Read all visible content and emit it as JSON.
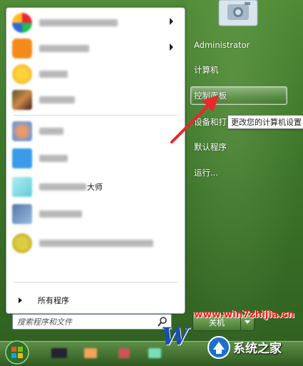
{
  "right_menu": {
    "user": "Administrator",
    "computer": "计算机",
    "control_panel": "控制面板",
    "devices_partial": "设备和打",
    "default_programs": "默认程序",
    "run": "运行..."
  },
  "tooltip": "更改您的计算机设置",
  "left_menu": {
    "blurred_item_suffix": "大师",
    "all_programs": "所有程序"
  },
  "search": {
    "placeholder": "搜索程序和文件"
  },
  "shutdown": {
    "label": "关机"
  },
  "watermark": {
    "url": "www.win7zhijia.cn",
    "logo_text": "系统之家"
  },
  "colors": {
    "annotation_arrow": "#e8282b",
    "url_text": "#ff1a1a",
    "start_green": "#3c7429"
  }
}
